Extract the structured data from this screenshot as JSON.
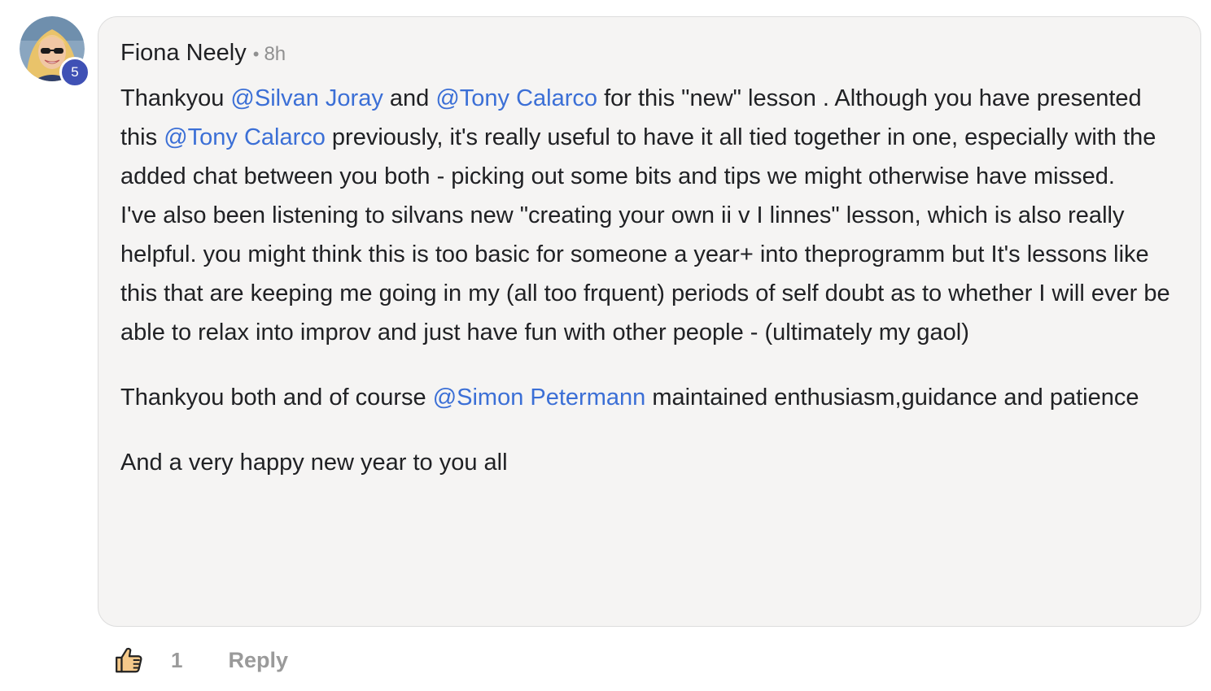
{
  "comment": {
    "author": "Fiona Neely",
    "separator": "•",
    "time": "8h",
    "level_badge": "5",
    "paragraphs": [
      [
        {
          "text": "Thankyou "
        },
        {
          "text": "@Silvan Joray",
          "mention": true
        },
        {
          "text": " and "
        },
        {
          "text": "@Tony Calarco",
          "mention": true
        },
        {
          "text": " for this \"new\" lesson . Although you have presented this "
        },
        {
          "text": "@Tony Calarco",
          "mention": true
        },
        {
          "text": " previously, it's really useful to have it all tied together in one, especially with the added chat between you both - picking out some bits and tips we might otherwise have missed."
        },
        {
          "break": true
        },
        {
          "text": "I've also been listening to silvans new \"creating your own ii v I linnes\" lesson, which is also really helpful. you might think this is too basic for someone a year+ into theprogramm but It's lessons like this that are keeping me going in my (all too frquent) periods of self doubt as to whether I will ever be able to relax into improv and just have fun with other people - (ultimately my gaol)"
        }
      ],
      [
        {
          "text": "Thankyou both and of course "
        },
        {
          "text": "@Simon Petermann",
          "mention": true
        },
        {
          "text": " maintained enthusiasm,guidance and patience"
        }
      ],
      [
        {
          "text": "And a very happy new year to you all"
        }
      ]
    ]
  },
  "actions": {
    "like_icon": "thumbs-up-icon",
    "like_count": "1",
    "reply_label": "Reply"
  },
  "colors": {
    "mention": "#3b6fd6",
    "bubble_bg": "#f5f4f3",
    "badge_bg": "#3f51b5",
    "muted": "#9a9a9a",
    "like_icon_fill": "#f5c98a"
  }
}
